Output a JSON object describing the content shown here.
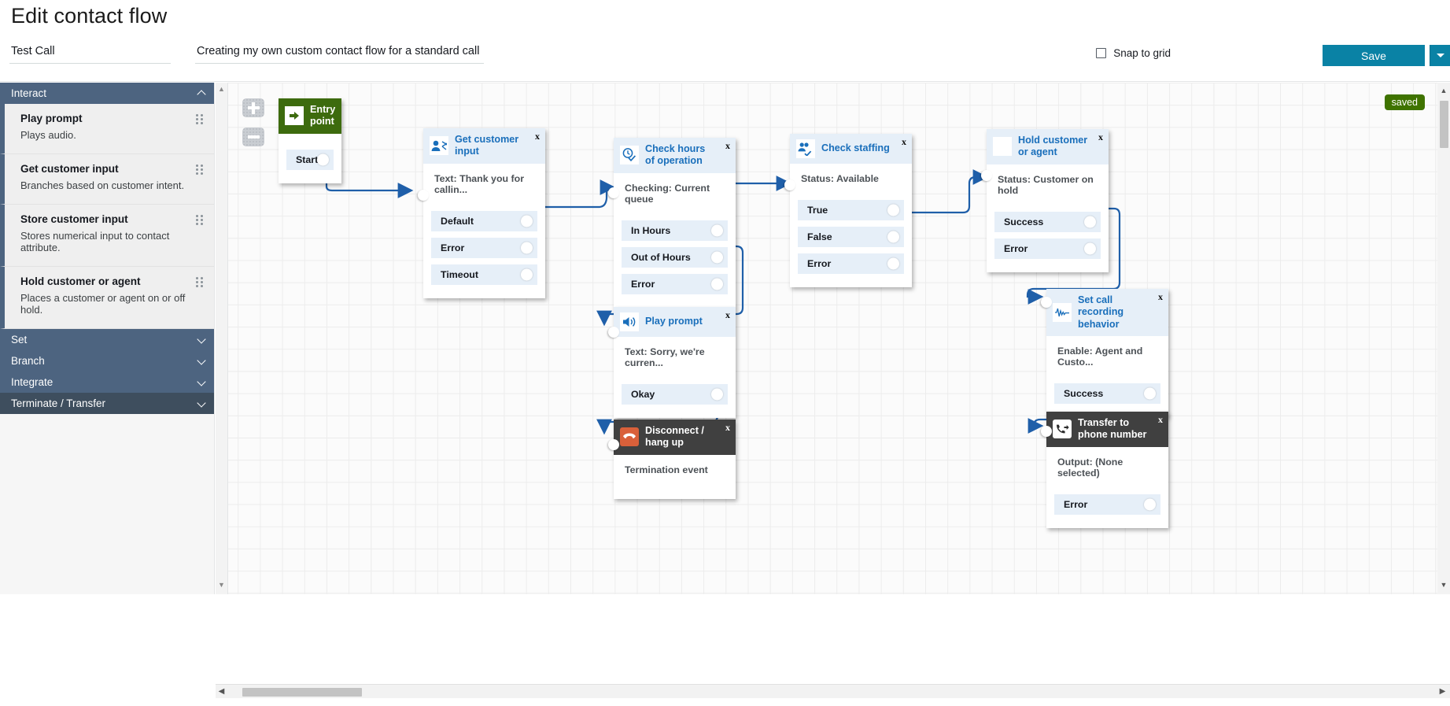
{
  "header": {
    "title": "Edit contact flow",
    "flow_name": "Test Call",
    "flow_description": "Creating my own custom contact flow for a standard call",
    "snap_to_grid_label": "Snap to grid",
    "save_label": "Save"
  },
  "sidebar": {
    "categories": [
      {
        "label": "Interact",
        "expanded": true,
        "blocks": [
          {
            "title": "Play prompt",
            "desc": "Plays audio."
          },
          {
            "title": "Get customer input",
            "desc": "Branches based on customer intent."
          },
          {
            "title": "Store customer input",
            "desc": "Stores numerical input to contact attribute."
          },
          {
            "title": "Hold customer or agent",
            "desc": "Places a customer or agent on or off hold."
          }
        ]
      },
      {
        "label": "Set",
        "expanded": false,
        "blocks": []
      },
      {
        "label": "Branch",
        "expanded": false,
        "blocks": []
      },
      {
        "label": "Integrate",
        "expanded": false,
        "blocks": []
      },
      {
        "label": "Terminate / Transfer",
        "expanded": false,
        "blocks": []
      }
    ]
  },
  "canvas": {
    "saved_badge": "saved",
    "zoom_in_label": "+",
    "zoom_out_label": "−",
    "nodes": [
      {
        "id": "entry-point",
        "title": "Entry point",
        "style": "green",
        "icon": "entry-arrow-icon",
        "subtitle": "",
        "ports": [
          "Start"
        ],
        "close": "x"
      },
      {
        "id": "get-customer-input",
        "title": "Get customer input",
        "style": "light",
        "icon": "customer-input-icon",
        "subtitle": "Text: Thank you for callin...",
        "ports": [
          "Default",
          "Error",
          "Timeout"
        ],
        "close": "x"
      },
      {
        "id": "check-hours-of-operation",
        "title": "Check hours of operation",
        "style": "light",
        "icon": "clock-check-icon",
        "subtitle": "Checking: Current queue",
        "ports": [
          "In Hours",
          "Out of Hours",
          "Error"
        ],
        "close": "x"
      },
      {
        "id": "check-staffing",
        "title": "Check staffing",
        "style": "light",
        "icon": "staffing-check-icon",
        "subtitle": "Status: Available",
        "ports": [
          "True",
          "False",
          "Error"
        ],
        "close": "x"
      },
      {
        "id": "hold-customer-or-agent",
        "title": "Hold customer or agent",
        "style": "light",
        "icon": "hold-icon",
        "subtitle": "Status: Customer on hold",
        "ports": [
          "Success",
          "Error"
        ],
        "close": "x"
      },
      {
        "id": "set-call-recording-behavior",
        "title": "Set call recording behavior",
        "style": "light",
        "icon": "waveform-icon",
        "subtitle": "Enable: Agent and Custo...",
        "ports": [
          "Success"
        ],
        "close": "x"
      },
      {
        "id": "play-prompt",
        "title": "Play prompt",
        "style": "light",
        "icon": "speaker-icon",
        "subtitle": "Text: Sorry, we're curren...",
        "ports": [
          "Okay"
        ],
        "close": "x"
      },
      {
        "id": "disconnect-hang-up",
        "title": "Disconnect / hang up",
        "style": "dark",
        "icon": "hangup-icon",
        "subtitle": "Termination event",
        "ports": [],
        "close": "x"
      },
      {
        "id": "transfer-to-phone-number",
        "title": "Transfer to phone number",
        "style": "dark",
        "icon": "transfer-phone-icon",
        "subtitle": "Output: (None selected)",
        "ports": [
          "Error"
        ],
        "close": "x"
      }
    ]
  },
  "colors": {
    "accent": "#0a82a5",
    "node_header": "#e6eff8",
    "node_title": "#1a6fbb",
    "sidebar_header": "#4d6480",
    "entry_green": "#3d6b0e",
    "edge": "#1f5fa9"
  }
}
